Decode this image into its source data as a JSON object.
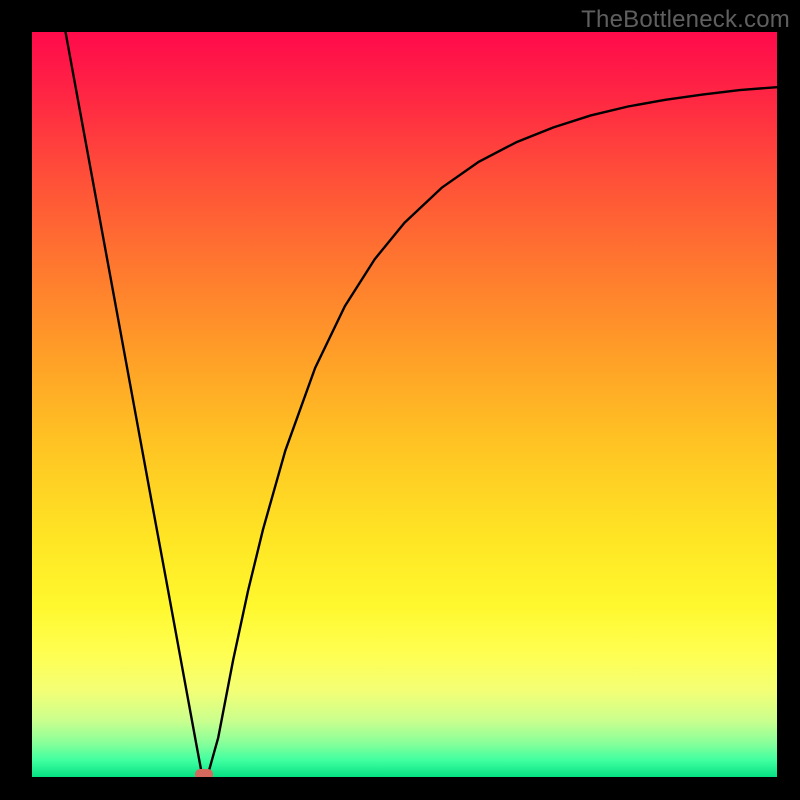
{
  "watermark": "TheBottleneck.com",
  "colors": {
    "background": "#000000",
    "watermark_text": "#5f5f5f",
    "curve_stroke": "#000000",
    "marker_fill": "#d46a5e",
    "gradient_stops": [
      {
        "offset": 0.0,
        "color": "#ff0a4b"
      },
      {
        "offset": 0.08,
        "color": "#ff2444"
      },
      {
        "offset": 0.18,
        "color": "#ff4a3a"
      },
      {
        "offset": 0.3,
        "color": "#ff7330"
      },
      {
        "offset": 0.42,
        "color": "#ff9a28"
      },
      {
        "offset": 0.55,
        "color": "#ffc323"
      },
      {
        "offset": 0.68,
        "color": "#ffe524"
      },
      {
        "offset": 0.77,
        "color": "#fff82e"
      },
      {
        "offset": 0.835,
        "color": "#ffff52"
      },
      {
        "offset": 0.885,
        "color": "#f3ff76"
      },
      {
        "offset": 0.925,
        "color": "#c9ff8e"
      },
      {
        "offset": 0.955,
        "color": "#86ff9a"
      },
      {
        "offset": 0.978,
        "color": "#3fffa0"
      },
      {
        "offset": 1.0,
        "color": "#05e082"
      }
    ]
  },
  "chart_data": {
    "type": "line",
    "title": "",
    "xlabel": "",
    "ylabel": "",
    "xlim": [
      0,
      100
    ],
    "ylim": [
      0,
      100
    ],
    "grid": false,
    "series": [
      {
        "name": "bottleneck-curve",
        "x": [
          4.5,
          6,
          8,
          10,
          12,
          14,
          16,
          18,
          20,
          22,
          22.8,
          23.6,
          25,
          27,
          29,
          31,
          34,
          38,
          42,
          46,
          50,
          55,
          60,
          65,
          70,
          75,
          80,
          85,
          90,
          95,
          100
        ],
        "y": [
          100,
          91.8,
          80.9,
          70.0,
          59.1,
          48.2,
          37.3,
          26.5,
          15.6,
          4.7,
          0.4,
          0.3,
          5.3,
          15.7,
          25.0,
          33.2,
          43.8,
          54.9,
          63.2,
          69.5,
          74.4,
          79.1,
          82.6,
          85.2,
          87.2,
          88.8,
          90.0,
          90.9,
          91.6,
          92.2,
          92.6
        ]
      }
    ],
    "annotations": [
      {
        "name": "optimal-marker",
        "x": 23.1,
        "y": 0.4
      }
    ]
  }
}
